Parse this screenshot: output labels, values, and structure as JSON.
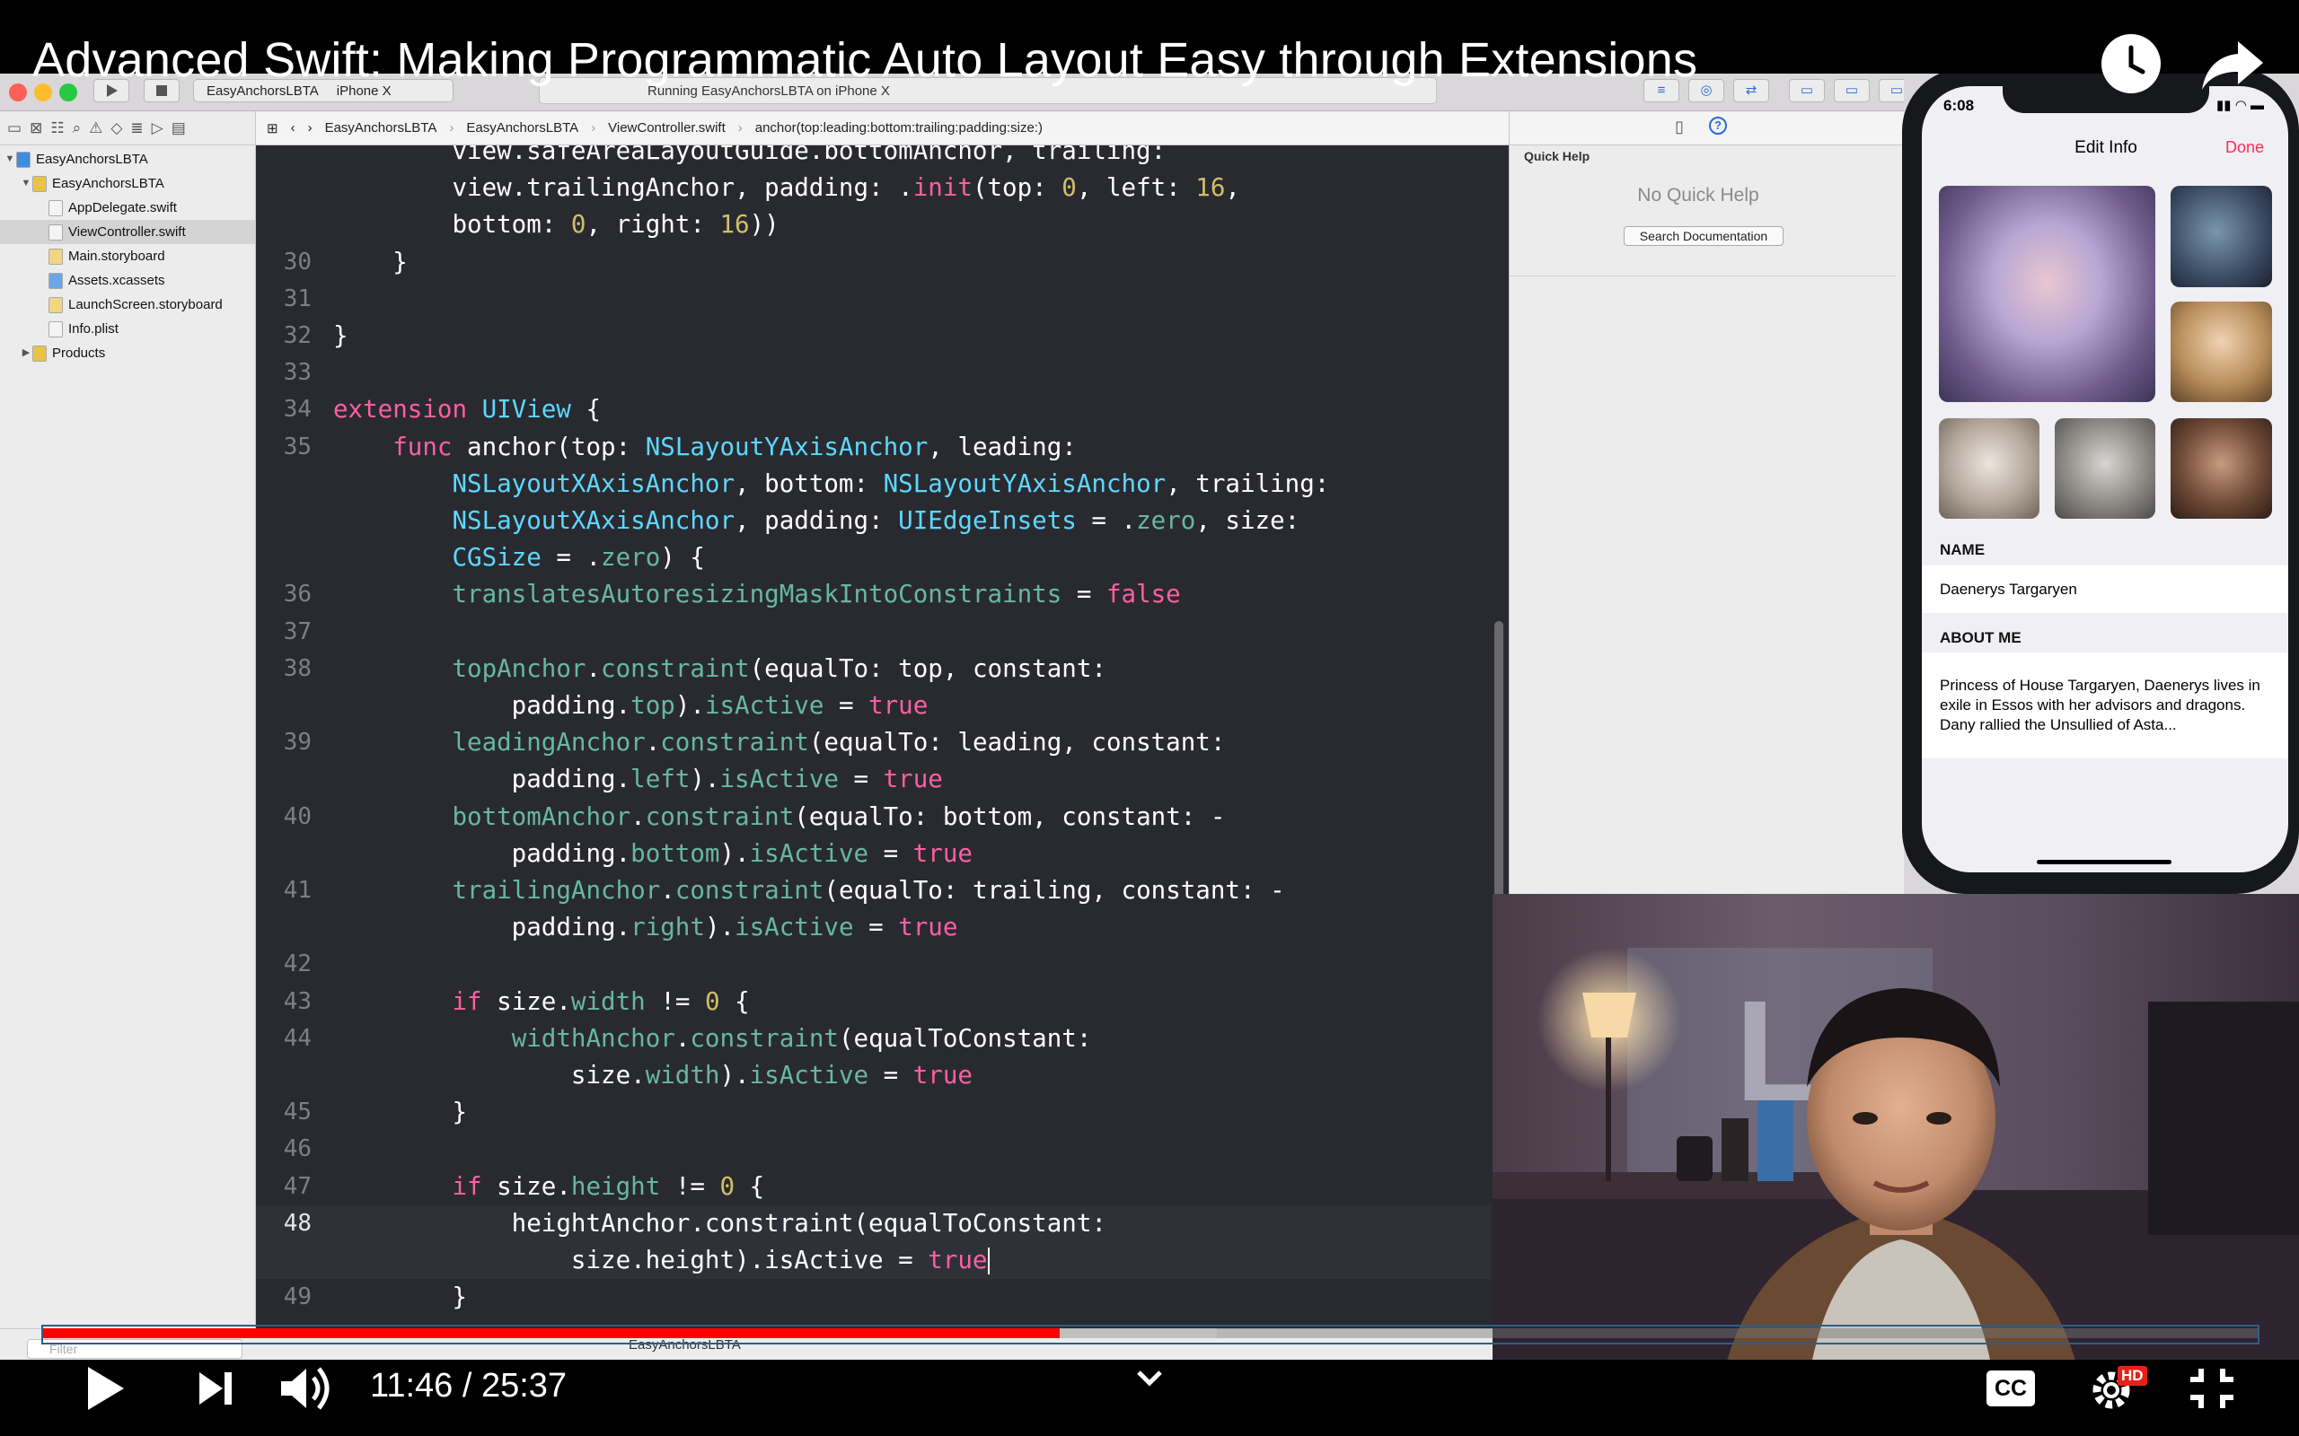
{
  "video": {
    "title": "Advanced Swift: Making Programmatic Auto Layout Easy through Extensions",
    "current_time": "11:46",
    "duration": "25:37",
    "time_display": "11:46 / 25:37",
    "progress_fraction": 0.459,
    "buffered_fraction": 0.53,
    "hd_badge": "HD",
    "cc_label": "CC"
  },
  "xcode": {
    "scheme": "EasyAnchorsLBTA",
    "destination": "iPhone X",
    "activity_status": "Running EasyAnchorsLBTA on iPhone X",
    "breadcrumbs": [
      "EasyAnchorsLBTA",
      "EasyAnchorsLBTA",
      "ViewController.swift",
      "anchor(top:leading:bottom:trailing:padding:size:)"
    ],
    "navigator": [
      {
        "label": "EasyAnchorsLBTA",
        "indent": 0,
        "disclosure": "open",
        "icon": "project-icon"
      },
      {
        "label": "EasyAnchorsLBTA",
        "indent": 1,
        "disclosure": "open",
        "icon": "folder-icon"
      },
      {
        "label": "AppDelegate.swift",
        "indent": 2,
        "disclosure": "",
        "icon": "swift-file-icon"
      },
      {
        "label": "ViewController.swift",
        "indent": 2,
        "disclosure": "",
        "icon": "swift-file-icon",
        "selected": true
      },
      {
        "label": "Main.storyboard",
        "indent": 2,
        "disclosure": "",
        "icon": "storyboard-icon"
      },
      {
        "label": "Assets.xcassets",
        "indent": 2,
        "disclosure": "",
        "icon": "assets-icon"
      },
      {
        "label": "LaunchScreen.storyboard",
        "indent": 2,
        "disclosure": "",
        "icon": "storyboard-icon"
      },
      {
        "label": "Info.plist",
        "indent": 2,
        "disclosure": "",
        "icon": "plist-icon"
      },
      {
        "label": "Products",
        "indent": 1,
        "disclosure": "closed",
        "icon": "folder-icon"
      }
    ],
    "filter_placeholder": "Filter",
    "debug_target": "EasyAnchorsLBTA",
    "quick_help": {
      "title": "Quick Help",
      "empty_text": "No Quick Help",
      "button": "Search Documentation"
    },
    "code_lines": [
      {
        "num": "",
        "tokens": [
          [
            "pl",
            "        view.safeAreaLayoutGuide.bottomAnchor, trailing:"
          ]
        ]
      },
      {
        "num": "",
        "tokens": [
          [
            "pl",
            "        view.trailingAnchor, padding: ."
          ],
          [
            "kw",
            "init"
          ],
          [
            "pl",
            "(top: "
          ],
          [
            "nm",
            "0"
          ],
          [
            "pl",
            ", left: "
          ],
          [
            "nm",
            "16"
          ],
          [
            "pl",
            ","
          ]
        ]
      },
      {
        "num": "",
        "tokens": [
          [
            "pl",
            "        bottom: "
          ],
          [
            "nm",
            "0"
          ],
          [
            "pl",
            ", right: "
          ],
          [
            "nm",
            "16"
          ],
          [
            "pl",
            "))"
          ]
        ]
      },
      {
        "num": "30",
        "tokens": [
          [
            "pl",
            "    }"
          ]
        ]
      },
      {
        "num": "31",
        "tokens": []
      },
      {
        "num": "32",
        "tokens": [
          [
            "pl",
            "}"
          ]
        ]
      },
      {
        "num": "33",
        "tokens": []
      },
      {
        "num": "34",
        "tokens": [
          [
            "kw",
            "extension"
          ],
          [
            "pl",
            " "
          ],
          [
            "ty",
            "UIView"
          ],
          [
            "pl",
            " {"
          ]
        ]
      },
      {
        "num": "35",
        "tokens": [
          [
            "pl",
            "    "
          ],
          [
            "kw",
            "func"
          ],
          [
            "pl",
            " anchor(top: "
          ],
          [
            "ty",
            "NSLayoutYAxisAnchor"
          ],
          [
            "pl",
            ", leading:"
          ]
        ]
      },
      {
        "num": "",
        "tokens": [
          [
            "pl",
            "        "
          ],
          [
            "ty",
            "NSLayoutXAxisAnchor"
          ],
          [
            "pl",
            ", bottom: "
          ],
          [
            "ty",
            "NSLayoutYAxisAnchor"
          ],
          [
            "pl",
            ", trailing:"
          ]
        ]
      },
      {
        "num": "",
        "tokens": [
          [
            "pl",
            "        "
          ],
          [
            "ty",
            "NSLayoutXAxisAnchor"
          ],
          [
            "pl",
            ", padding: "
          ],
          [
            "ty",
            "UIEdgeInsets"
          ],
          [
            "pl",
            " = ."
          ],
          [
            "pr",
            "zero"
          ],
          [
            "pl",
            ", size:"
          ]
        ]
      },
      {
        "num": "",
        "tokens": [
          [
            "pl",
            "        "
          ],
          [
            "ty",
            "CGSize"
          ],
          [
            "pl",
            " = ."
          ],
          [
            "pr",
            "zero"
          ],
          [
            "pl",
            ") {"
          ]
        ]
      },
      {
        "num": "36",
        "tokens": [
          [
            "pl",
            "        "
          ],
          [
            "pr",
            "translatesAutoresizingMaskIntoConstraints"
          ],
          [
            "pl",
            " = "
          ],
          [
            "kw",
            "false"
          ]
        ]
      },
      {
        "num": "37",
        "tokens": []
      },
      {
        "num": "38",
        "tokens": [
          [
            "pl",
            "        "
          ],
          [
            "pr",
            "topAnchor"
          ],
          [
            "pl",
            "."
          ],
          [
            "pr",
            "constraint"
          ],
          [
            "pl",
            "(equalTo: top, constant:"
          ]
        ]
      },
      {
        "num": "",
        "tokens": [
          [
            "pl",
            "            padding."
          ],
          [
            "pr",
            "top"
          ],
          [
            "pl",
            ")."
          ],
          [
            "pr",
            "isActive"
          ],
          [
            "pl",
            " = "
          ],
          [
            "kw",
            "true"
          ]
        ]
      },
      {
        "num": "39",
        "tokens": [
          [
            "pl",
            "        "
          ],
          [
            "pr",
            "leadingAnchor"
          ],
          [
            "pl",
            "."
          ],
          [
            "pr",
            "constraint"
          ],
          [
            "pl",
            "(equalTo: leading, constant:"
          ]
        ]
      },
      {
        "num": "",
        "tokens": [
          [
            "pl",
            "            padding."
          ],
          [
            "pr",
            "left"
          ],
          [
            "pl",
            ")."
          ],
          [
            "pr",
            "isActive"
          ],
          [
            "pl",
            " = "
          ],
          [
            "kw",
            "true"
          ]
        ]
      },
      {
        "num": "40",
        "tokens": [
          [
            "pl",
            "        "
          ],
          [
            "pr",
            "bottomAnchor"
          ],
          [
            "pl",
            "."
          ],
          [
            "pr",
            "constraint"
          ],
          [
            "pl",
            "(equalTo: bottom, constant: -"
          ]
        ]
      },
      {
        "num": "",
        "tokens": [
          [
            "pl",
            "            padding."
          ],
          [
            "pr",
            "bottom"
          ],
          [
            "pl",
            ")."
          ],
          [
            "pr",
            "isActive"
          ],
          [
            "pl",
            " = "
          ],
          [
            "kw",
            "true"
          ]
        ]
      },
      {
        "num": "41",
        "tokens": [
          [
            "pl",
            "        "
          ],
          [
            "pr",
            "trailingAnchor"
          ],
          [
            "pl",
            "."
          ],
          [
            "pr",
            "constraint"
          ],
          [
            "pl",
            "(equalTo: trailing, constant: -"
          ]
        ]
      },
      {
        "num": "",
        "tokens": [
          [
            "pl",
            "            padding."
          ],
          [
            "pr",
            "right"
          ],
          [
            "pl",
            ")."
          ],
          [
            "pr",
            "isActive"
          ],
          [
            "pl",
            " = "
          ],
          [
            "kw",
            "true"
          ]
        ]
      },
      {
        "num": "42",
        "tokens": []
      },
      {
        "num": "43",
        "tokens": [
          [
            "pl",
            "        "
          ],
          [
            "kw",
            "if"
          ],
          [
            "pl",
            " size."
          ],
          [
            "pr",
            "width"
          ],
          [
            "pl",
            " != "
          ],
          [
            "nm",
            "0"
          ],
          [
            "pl",
            " {"
          ]
        ]
      },
      {
        "num": "44",
        "tokens": [
          [
            "pl",
            "            "
          ],
          [
            "pr",
            "widthAnchor"
          ],
          [
            "pl",
            "."
          ],
          [
            "pr",
            "constraint"
          ],
          [
            "pl",
            "(equalToConstant:"
          ]
        ]
      },
      {
        "num": "",
        "tokens": [
          [
            "pl",
            "                size."
          ],
          [
            "pr",
            "width"
          ],
          [
            "pl",
            ")."
          ],
          [
            "pr",
            "isActive"
          ],
          [
            "pl",
            " = "
          ],
          [
            "kw",
            "true"
          ]
        ]
      },
      {
        "num": "45",
        "tokens": [
          [
            "pl",
            "        }"
          ]
        ]
      },
      {
        "num": "46",
        "tokens": []
      },
      {
        "num": "47",
        "tokens": [
          [
            "pl",
            "        "
          ],
          [
            "kw",
            "if"
          ],
          [
            "pl",
            " size."
          ],
          [
            "pr",
            "height"
          ],
          [
            "pl",
            " != "
          ],
          [
            "nm",
            "0"
          ],
          [
            "pl",
            " {"
          ]
        ]
      },
      {
        "num": "48",
        "current": true,
        "tokens": [
          [
            "pl",
            "            heightAnchor.constraint(equalToConstant:"
          ]
        ]
      },
      {
        "num": "",
        "current": true,
        "tokens": [
          [
            "pl",
            "                size.height).isActive = "
          ],
          [
            "kw",
            "true"
          ]
        ],
        "cursor": true
      },
      {
        "num": "49",
        "tokens": [
          [
            "pl",
            "        }"
          ]
        ]
      }
    ],
    "syntax_colors": {
      "pl": "#ffffff",
      "kw": "#fc5fa3",
      "ty": "#5dd8ff",
      "pr": "#67b7a4",
      "nm": "#d0bf69"
    }
  },
  "simulator": {
    "status_time": "6:08",
    "nav_title": "Edit Info",
    "nav_done": "Done",
    "name_header": "NAME",
    "name_value": "Daenerys Targaryen",
    "about_header": "ABOUT ME",
    "about_text": "Princess of House Targaryen, Daenerys lives in exile in Essos with her advisors and dragons. Dany rallied the Unsullied of Asta...",
    "accent_color": "#ff2d55"
  }
}
